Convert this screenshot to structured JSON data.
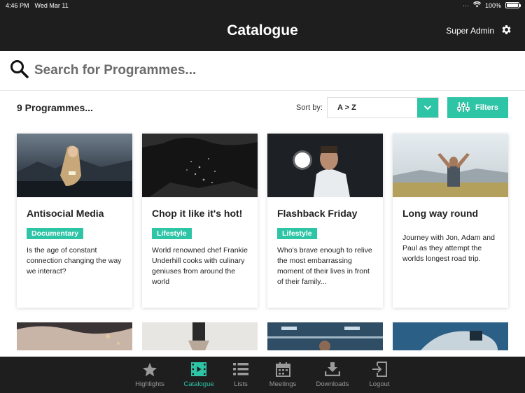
{
  "status": {
    "time": "4:46 PM",
    "date": "Wed Mar 11",
    "battery": "100%",
    "battery_level": 1.0
  },
  "header": {
    "title": "Catalogue",
    "user": "Super Admin"
  },
  "search": {
    "placeholder": "Search for Programmes..."
  },
  "controls": {
    "count": "9 Programmes...",
    "sort_label": "Sort by:",
    "sort_value": "A > Z",
    "filters_label": "Filters"
  },
  "cards": [
    {
      "title": "Antisocial Media",
      "tag": "Documentary",
      "description": "Is the age of constant connection changing the way we interact?"
    },
    {
      "title": "Chop it like it's hot!",
      "tag": "Lifestyle",
      "description": "World renowned chef Frankie Underhill cooks with culinary geniuses from around the world"
    },
    {
      "title": "Flashback Friday",
      "tag": "Lifestyle",
      "description": "Who's brave enough to relive the most embarrassing moment of their lives in front of their family..."
    },
    {
      "title": "Long way round",
      "tag": "",
      "description": "Journey with Jon, Adam and Paul as they attempt the worlds longest road trip."
    }
  ],
  "tabs": [
    {
      "label": "Highlights",
      "icon": "star-icon",
      "active": false
    },
    {
      "label": "Catalogue",
      "icon": "film-icon",
      "active": true
    },
    {
      "label": "Lists",
      "icon": "list-icon",
      "active": false
    },
    {
      "label": "Meetings",
      "icon": "calendar-icon",
      "active": false
    },
    {
      "label": "Downloads",
      "icon": "download-icon",
      "active": false
    },
    {
      "label": "Logout",
      "icon": "logout-icon",
      "active": false
    }
  ],
  "colors": {
    "accent": "#2ec4a6",
    "bar": "#1e1e1e"
  }
}
